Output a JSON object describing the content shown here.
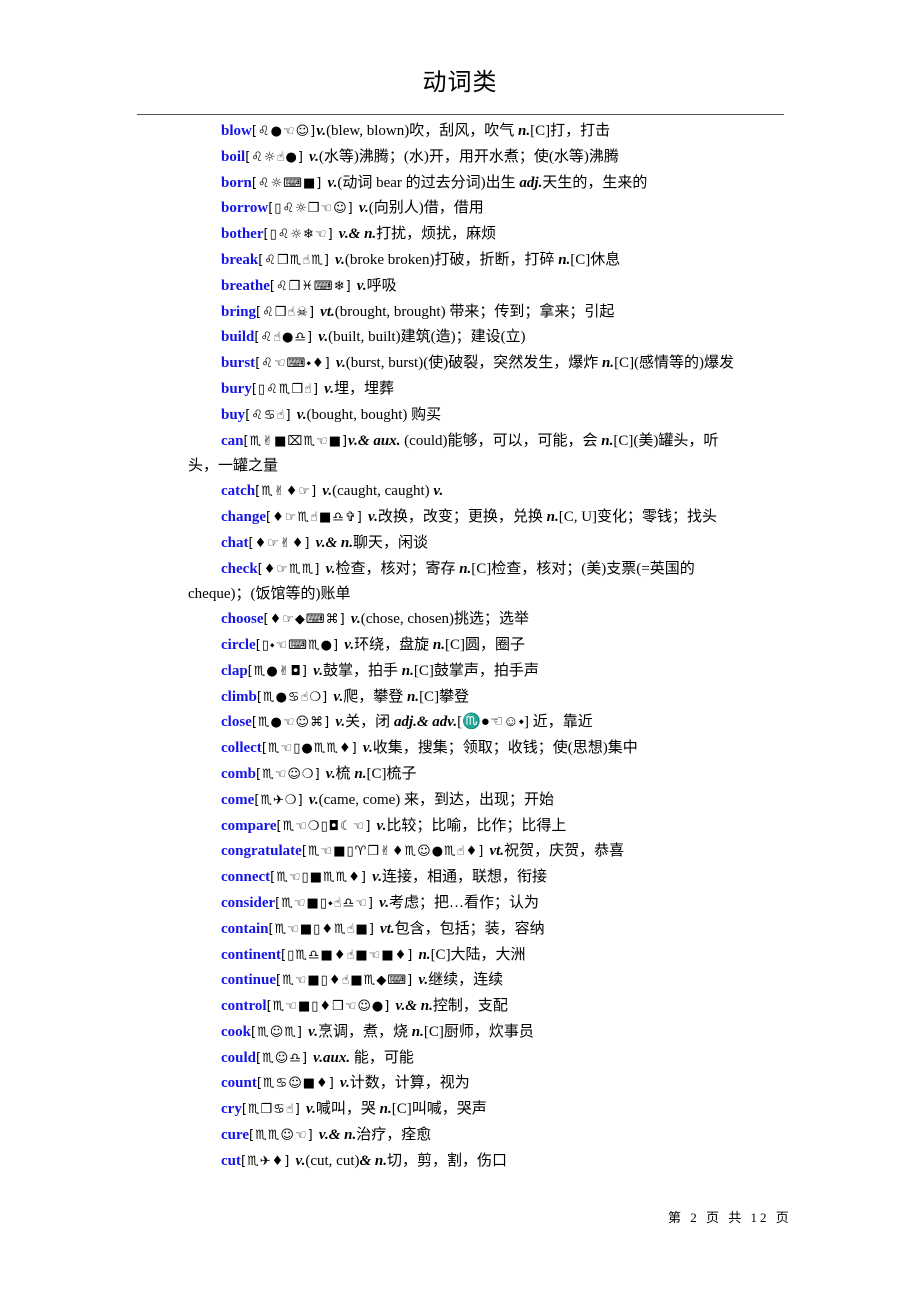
{
  "page": {
    "title": "动词类",
    "footer": "第 2 页 共 12 页"
  },
  "entries": [
    {
      "word": "blow",
      "phon": "[♌●☜☺]",
      "def": [
        {
          "pos": "v.",
          "text": "(blew, blown)吹，刮风，吹气 "
        },
        {
          "pos": "n.",
          "text": "[C]打，打击"
        }
      ]
    },
    {
      "word": "boil",
      "phon": "[♌☼☝●] ",
      "def": [
        {
          "pos": "v.",
          "text": "(水等)沸腾；(水)开，用开水煮；使(水等)沸腾"
        }
      ]
    },
    {
      "word": "born",
      "phon": "[♌☼⌨■] ",
      "def": [
        {
          "pos": "v.",
          "text": "(动词 bear 的过去分词)出生 "
        },
        {
          "pos": "adj.",
          "text": "天生的，生来的"
        }
      ]
    },
    {
      "word": "borrow",
      "phon": "[▯♌☼❒☜☺] ",
      "def": [
        {
          "pos": "v.",
          "text": "(向别人)借，借用"
        }
      ]
    },
    {
      "word": "bother",
      "phon": "[▯♌☼❄☜] ",
      "def": [
        {
          "pos": "v.& n.",
          "text": "打扰，烦扰，麻烦"
        }
      ]
    },
    {
      "word": "break",
      "phon": "[♌❒♏☝♏] ",
      "def": [
        {
          "pos": "v.",
          "text": "(broke broken)打破，折断，打碎 "
        },
        {
          "pos": "n.",
          "text": "[C]休息"
        }
      ]
    },
    {
      "word": "breathe",
      "phon": "[♌❒♓⌨❄] ",
      "def": [
        {
          "pos": "v.",
          "text": "呼吸"
        }
      ]
    },
    {
      "word": "bring",
      "phon": "[♌❒☝☠] ",
      "def": [
        {
          "pos": "vt.",
          "text": "(brought, brought) 带来；传到；拿来；引起"
        }
      ]
    },
    {
      "word": "build",
      "phon": "[♌☝●♎] ",
      "def": [
        {
          "pos": "v.",
          "text": "(built, built)建筑(造)；建设(立)"
        }
      ]
    },
    {
      "word": "burst",
      "phon": "[♌☜⌨⬩♦] ",
      "def": [
        {
          "pos": "v.",
          "text": "(burst, burst)(使)破裂，突然发生，爆炸 "
        },
        {
          "pos": "n.",
          "text": "[C](感情等的)爆发"
        }
      ]
    },
    {
      "word": "bury",
      "phon": "[▯♌♏❒☝] ",
      "def": [
        {
          "pos": "v.",
          "text": "埋，埋葬"
        }
      ]
    },
    {
      "word": "buy",
      "phon": "[♌♋☝] ",
      "def": [
        {
          "pos": "v.",
          "text": "(bought, bought) 购买"
        }
      ]
    },
    {
      "word": "can",
      "phon": "[♏✌■⌧♏☜■]",
      "def": [
        {
          "pos": "v.& aux.",
          "text": " (could)能够，可以，可能，会 "
        },
        {
          "pos": "n.",
          "text": "[C](美)罐头，听头，一罐之量"
        }
      ]
    },
    {
      "word": "catch",
      "phon": "[♏✌♦☞] ",
      "def": [
        {
          "pos": "v.",
          "text": "(caught, caught) "
        },
        {
          "pos": "v.",
          "text": ""
        }
      ]
    },
    {
      "word": "change",
      "phon": "[♦☞♏☝■♎✞] ",
      "def": [
        {
          "pos": "v.",
          "text": "改换，改变；更换，兑换 "
        },
        {
          "pos": "n.",
          "text": "[C, U]变化；零钱；找头"
        }
      ]
    },
    {
      "word": "chat",
      "phon": "[♦☞✌♦] ",
      "def": [
        {
          "pos": "v.& n.",
          "text": "聊天，闲谈"
        }
      ]
    },
    {
      "word": "check",
      "phon": "[♦☞♏♏] ",
      "def": [
        {
          "pos": "v.",
          "text": "检查，核对；寄存 "
        },
        {
          "pos": "n.",
          "text": "[C]检查，核对；(美)支票(=英国的 cheque)；(饭馆等的)账单"
        }
      ]
    },
    {
      "word": "choose",
      "phon": "[♦☞◆⌨⌘] ",
      "def": [
        {
          "pos": "v.",
          "text": "(chose, chosen)挑选；选举"
        }
      ]
    },
    {
      "word": "circle",
      "phon": "[▯⬩☜⌨♏●] ",
      "def": [
        {
          "pos": "v.",
          "text": "环绕，盘旋 "
        },
        {
          "pos": "n.",
          "text": "[C]圆，圈子"
        }
      ]
    },
    {
      "word": "clap",
      "phon": "[♏●✌◘] ",
      "def": [
        {
          "pos": "v.",
          "text": "鼓掌，拍手 "
        },
        {
          "pos": "n.",
          "text": "[C]鼓掌声，拍手声"
        }
      ]
    },
    {
      "word": "climb",
      "phon": "[♏●♋☝❍] ",
      "def": [
        {
          "pos": "v.",
          "text": "爬，攀登 "
        },
        {
          "pos": "n.",
          "text": "[C]攀登"
        }
      ]
    },
    {
      "word": "close",
      "phon": "[♏●☜☺⌘] ",
      "def": [
        {
          "pos": "v.",
          "text": "关，闭 "
        },
        {
          "pos": "adj.& adv.",
          "text": "[♏●☜☺⬩] 近，靠近"
        }
      ]
    },
    {
      "word": "collect",
      "phon": "[♏☜▯●♏♏♦] ",
      "def": [
        {
          "pos": "v.",
          "text": "收集，搜集；领取；收钱；使(思想)集中"
        }
      ]
    },
    {
      "word": "comb",
      "phon": "[♏☜☺❍] ",
      "def": [
        {
          "pos": "v.",
          "text": "梳 "
        },
        {
          "pos": "n.",
          "text": "[C]梳子"
        }
      ]
    },
    {
      "word": "come",
      "phon": "[♏✈❍] ",
      "def": [
        {
          "pos": "v.",
          "text": "(came, come) 来，到达，出现；开始"
        }
      ]
    },
    {
      "word": "compare",
      "phon": "[♏☜❍▯◘☾☜] ",
      "def": [
        {
          "pos": "v.",
          "text": "比较；比喻，比作；比得上"
        }
      ]
    },
    {
      "word": "congratulate",
      "phon": "[♏☜■▯♈❒✌♦♏☺●♏☝♦] ",
      "def": [
        {
          "pos": "vt.",
          "text": "祝贺，庆贺，恭喜"
        }
      ]
    },
    {
      "word": "connect",
      "phon": "[♏☜▯■♏♏♦] ",
      "def": [
        {
          "pos": "v.",
          "text": "连接，相通，联想，衔接"
        }
      ]
    },
    {
      "word": "consider",
      "phon": "[♏☜■▯⬩☝♎☜] ",
      "def": [
        {
          "pos": "v.",
          "text": "考虑；把…看作；认为"
        }
      ]
    },
    {
      "word": "contain",
      "phon": "[♏☜■▯♦♏☝■] ",
      "def": [
        {
          "pos": "vt.",
          "text": "包含，包括；装，容纳"
        }
      ]
    },
    {
      "word": "continent",
      "phon": "[▯♏♎■♦☝■☜■♦] ",
      "def": [
        {
          "pos": "n.",
          "text": "[C]大陆，大洲"
        }
      ]
    },
    {
      "word": "continue",
      "phon": "[♏☜■▯♦☝■♏◆⌨] ",
      "def": [
        {
          "pos": "v.",
          "text": "继续，连续"
        }
      ]
    },
    {
      "word": "control",
      "phon": "[♏☜■▯♦❒☜☺●] ",
      "def": [
        {
          "pos": "v.& n.",
          "text": "控制，支配"
        }
      ]
    },
    {
      "word": "cook",
      "phon": "[♏☺♏] ",
      "def": [
        {
          "pos": "v.",
          "text": "烹调，煮，烧 "
        },
        {
          "pos": "n.",
          "text": "[C]厨师，炊事员"
        }
      ]
    },
    {
      "word": "could",
      "phon": "[♏☺♎] ",
      "def": [
        {
          "pos": "v.aux.",
          "text": " 能，可能"
        }
      ]
    },
    {
      "word": "count",
      "phon": "[♏♋☺■♦] ",
      "def": [
        {
          "pos": "v.",
          "text": "计数，计算，视为"
        }
      ]
    },
    {
      "word": "cry",
      "phon": "[♏❒♋☝] ",
      "def": [
        {
          "pos": "v.",
          "text": "喊叫，哭 "
        },
        {
          "pos": "n.",
          "text": "[C]叫喊，哭声"
        }
      ]
    },
    {
      "word": "cure",
      "phon": "[♏♏☺☜] ",
      "def": [
        {
          "pos": "v.& n.",
          "text": "治疗，痊愈"
        }
      ]
    },
    {
      "word": "cut",
      "phon": "[♏✈♦] ",
      "def": [
        {
          "pos": "v.",
          "text": "(cut, cut)"
        },
        {
          "pos": "& n.",
          "text": "切，剪，割，伤口"
        }
      ]
    }
  ]
}
